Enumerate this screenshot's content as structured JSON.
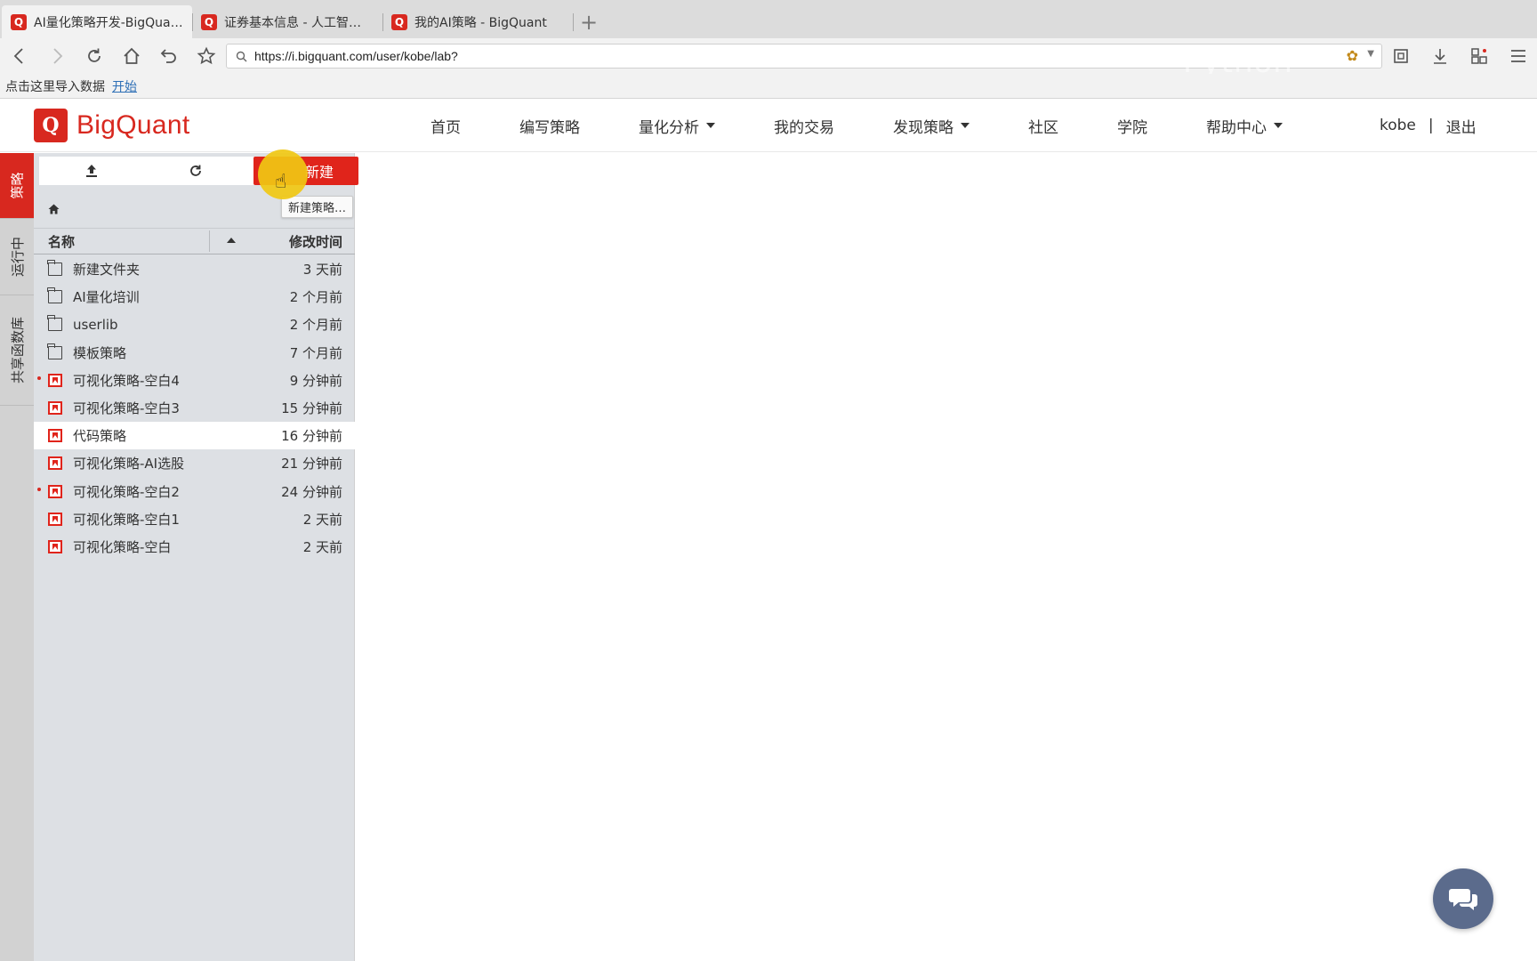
{
  "browser": {
    "tabs": [
      {
        "title": "AI量化策略开发-BigQua…",
        "active": true
      },
      {
        "title": "证券基本信息 - 人工智…",
        "active": false
      },
      {
        "title": "我的AI策略 - BigQuant",
        "active": false
      }
    ],
    "new_tab_label": "+",
    "favicon_letter": "Q",
    "url": "https://i.bigquant.com/user/kobe/lab?",
    "bookmarks": {
      "prompt": "点击这里导入数据",
      "start_link": "开始"
    },
    "watermark": "Python"
  },
  "site": {
    "logo_mark": "Q",
    "logo_text": "BigQuant",
    "nav": [
      {
        "label": "首页",
        "dropdown": false
      },
      {
        "label": "编写策略",
        "dropdown": false
      },
      {
        "label": "量化分析",
        "dropdown": true
      },
      {
        "label": "我的交易",
        "dropdown": false
      },
      {
        "label": "发现策略",
        "dropdown": true
      },
      {
        "label": "社区",
        "dropdown": false
      },
      {
        "label": "学院",
        "dropdown": false
      },
      {
        "label": "帮助中心",
        "dropdown": true
      }
    ],
    "user": {
      "name": "kobe",
      "separator": "|",
      "logout": "退出"
    }
  },
  "side_tabs": [
    {
      "label": "策略",
      "active": true
    },
    {
      "label": "运行中",
      "active": false
    },
    {
      "label": "共享函数库",
      "active": false
    }
  ],
  "panel": {
    "new_button_label": "新建",
    "tooltip": "新建策略…",
    "columns": {
      "name": "名称",
      "modified": "修改时间"
    },
    "files": [
      {
        "type": "folder",
        "name": "新建文件夹",
        "time": "3 天前",
        "running": false,
        "selected": false
      },
      {
        "type": "folder",
        "name": "AI量化培训",
        "time": "2 个月前",
        "running": false,
        "selected": false
      },
      {
        "type": "folder",
        "name": "userlib",
        "time": "2 个月前",
        "running": false,
        "selected": false
      },
      {
        "type": "folder",
        "name": "模板策略",
        "time": "7 个月前",
        "running": false,
        "selected": false
      },
      {
        "type": "strategy",
        "name": "可视化策略-空白4",
        "time": "9 分钟前",
        "running": true,
        "selected": false
      },
      {
        "type": "strategy",
        "name": "可视化策略-空白3",
        "time": "15 分钟前",
        "running": false,
        "selected": false
      },
      {
        "type": "strategy",
        "name": "代码策略",
        "time": "16 分钟前",
        "running": false,
        "selected": true
      },
      {
        "type": "strategy",
        "name": "可视化策略-AI选股",
        "time": "21 分钟前",
        "running": false,
        "selected": false
      },
      {
        "type": "strategy",
        "name": "可视化策略-空白2",
        "time": "24 分钟前",
        "running": true,
        "selected": false
      },
      {
        "type": "strategy",
        "name": "可视化策略-空白1",
        "time": "2 天前",
        "running": false,
        "selected": false
      },
      {
        "type": "strategy",
        "name": "可视化策略-空白",
        "time": "2 天前",
        "running": false,
        "selected": false
      }
    ]
  },
  "colors": {
    "brand": "#d8281f",
    "button": "#e0241b",
    "panel_bg": "#dde0e4",
    "chat": "#5b6b8c",
    "cursor_highlight": "#f0c814"
  }
}
